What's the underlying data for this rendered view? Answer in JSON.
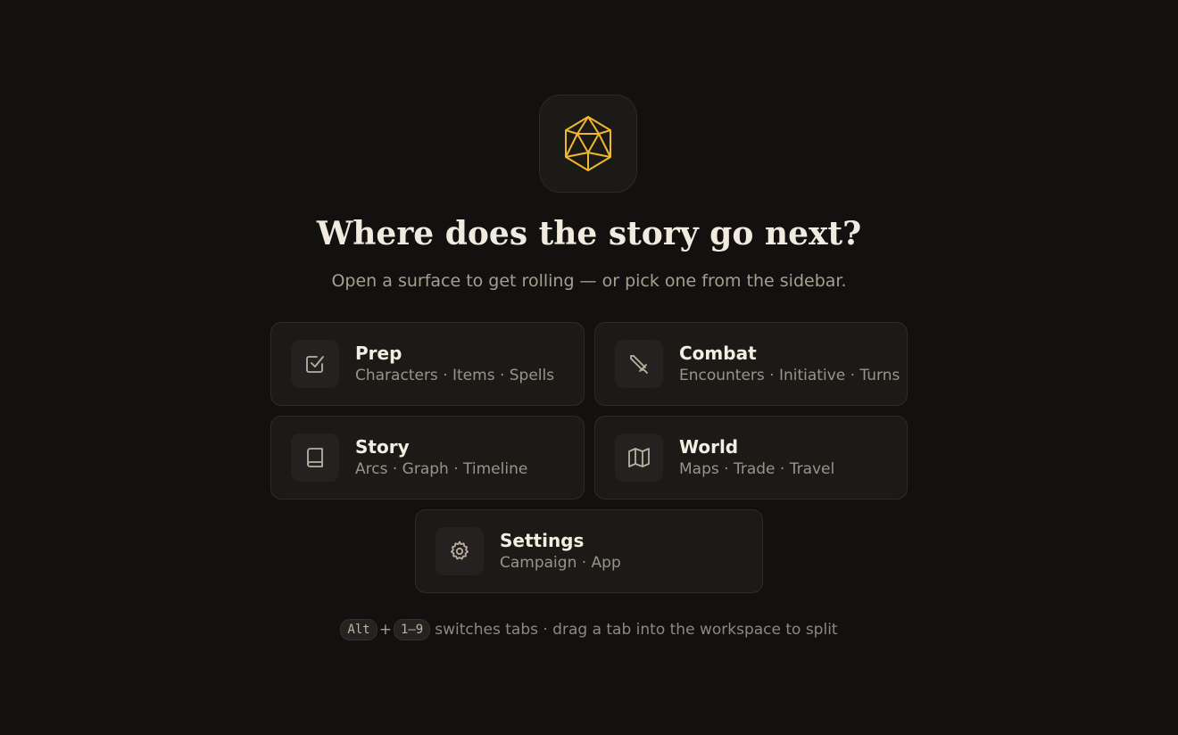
{
  "logo": {
    "icon": "d20-icon",
    "color": "#f0b72f"
  },
  "headline": "Where does the story go next?",
  "subtitle": "Open a surface to get rolling — or pick one from the sidebar.",
  "cards": {
    "prep": {
      "title": "Prep",
      "desc": "Characters · Items · Spells",
      "icon": "checkbox-icon"
    },
    "combat": {
      "title": "Combat",
      "desc": "Encounters · Initiative · Turns",
      "icon": "sword-icon"
    },
    "story": {
      "title": "Story",
      "desc": "Arcs · Graph · Timeline",
      "icon": "book-icon"
    },
    "world": {
      "title": "World",
      "desc": "Maps · Trade · Travel",
      "icon": "map-icon"
    },
    "settings": {
      "title": "Settings",
      "desc": "Campaign · App",
      "icon": "gear-icon"
    }
  },
  "hint": {
    "key1": "Alt",
    "plus": "+",
    "key2": "1–9",
    "text": "switches tabs · drag a tab into the workspace to split"
  },
  "colors": {
    "accent": "#f0b72f",
    "background": "#121110",
    "card": "#1b1a17"
  }
}
